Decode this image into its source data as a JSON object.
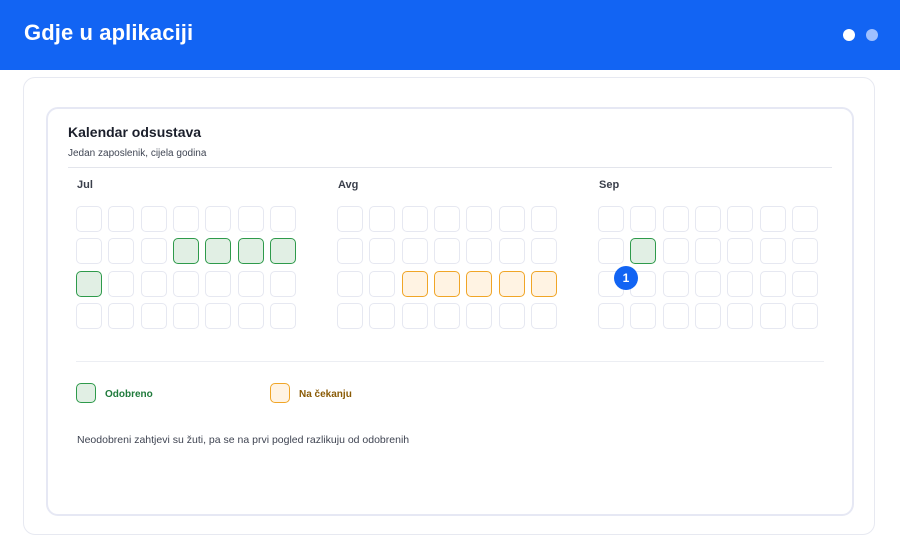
{
  "header": {
    "title": "Gdje u aplikaciji",
    "pager_dots": [
      {
        "state": "active",
        "color": "#ffffff"
      },
      {
        "state": "inactive",
        "color": "#9fc0ff"
      }
    ]
  },
  "calendar": {
    "title": "Kalendar odsustava",
    "subtitle": "Jedan zaposlenik, cijela godina",
    "months": [
      {
        "label": "Jul",
        "rows": [
          [
            "empty",
            "empty",
            "empty",
            "empty",
            "empty",
            "empty",
            "empty"
          ],
          [
            "empty",
            "empty",
            "empty",
            "approved",
            "approved",
            "approved",
            "approved"
          ],
          [
            "approved",
            "empty",
            "empty",
            "empty",
            "empty",
            "empty",
            "empty"
          ],
          [
            "empty",
            "empty",
            "empty",
            "empty",
            "empty",
            "empty",
            "empty"
          ]
        ]
      },
      {
        "label": "Avg",
        "rows": [
          [
            "empty",
            "empty",
            "empty",
            "empty",
            "empty",
            "empty",
            "empty"
          ],
          [
            "empty",
            "empty",
            "empty",
            "empty",
            "empty",
            "empty",
            "empty"
          ],
          [
            "empty",
            "empty",
            "pending",
            "pending",
            "pending",
            "pending",
            "pending"
          ],
          [
            "empty",
            "empty",
            "empty",
            "empty",
            "empty",
            "empty",
            "empty"
          ]
        ]
      },
      {
        "label": "Sep",
        "rows": [
          [
            "empty",
            "empty",
            "empty",
            "empty",
            "empty",
            "empty",
            "empty"
          ],
          [
            "empty",
            "approved",
            "empty",
            "empty",
            "empty",
            "empty",
            "empty"
          ],
          [
            "empty",
            "empty",
            "empty",
            "empty",
            "empty",
            "empty",
            "empty"
          ],
          [
            "empty",
            "empty",
            "empty",
            "empty",
            "empty",
            "empty",
            "empty"
          ]
        ]
      }
    ],
    "marker_badge": "1",
    "legend": {
      "approved": "Odobreno",
      "pending": "Na čekanju"
    },
    "note": "Neodobreni zahtjevi su žuti, pa se na prvi pogled razlikuju od odobrenih",
    "colors": {
      "accent": "#1264f3",
      "approved_border": "#2e9a4b",
      "approved_fill": "#e1efe4",
      "pending_border": "#f0a527",
      "pending_fill": "#fff3e3"
    }
  }
}
